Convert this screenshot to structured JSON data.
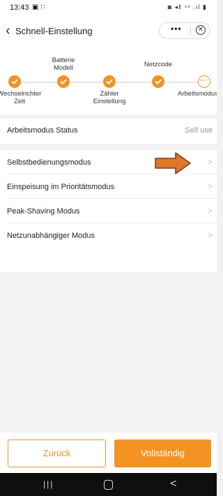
{
  "statusbar": {
    "time": "13:43",
    "left_icons": "▣ ∷",
    "right_icons": "◙ ◂ǁ ⁴⁶ .ıl ▮"
  },
  "header": {
    "back_icon": "back-chevron",
    "title": "Schnell-Einstellung",
    "more_label": "•••",
    "close_glyph": "✕"
  },
  "stepper": {
    "steps": [
      {
        "label": "Wechselrichter\nZeit",
        "state": "done"
      },
      {
        "label": "Batterie\nModell",
        "state": "done"
      },
      {
        "label": "Zähler\nEinstellung",
        "state": "done"
      },
      {
        "label": "Netzcode",
        "state": "done"
      },
      {
        "label": "Arbeitsmodus",
        "state": "current"
      }
    ],
    "current_glyph": "···",
    "accent": "#f39324"
  },
  "status": {
    "label": "Arbeitsmodus Status",
    "value": "Self use"
  },
  "modes": [
    {
      "label": "Selbstbedienungsmodus"
    },
    {
      "label": "Einspeisung im Prioritätsmodus"
    },
    {
      "label": "Peak-Shaving Modus"
    },
    {
      "label": "Netzunabhängiger Modus"
    }
  ],
  "chevron": ">",
  "footer": {
    "back_label": "Zurück",
    "done_label": "Vollständig"
  },
  "navbar": {
    "recent_glyph": "|||",
    "back_glyph": "<"
  },
  "colors": {
    "accent": "#f39324",
    "arrow_fill": "#e0762a",
    "arrow_stroke": "#7a3c12"
  }
}
